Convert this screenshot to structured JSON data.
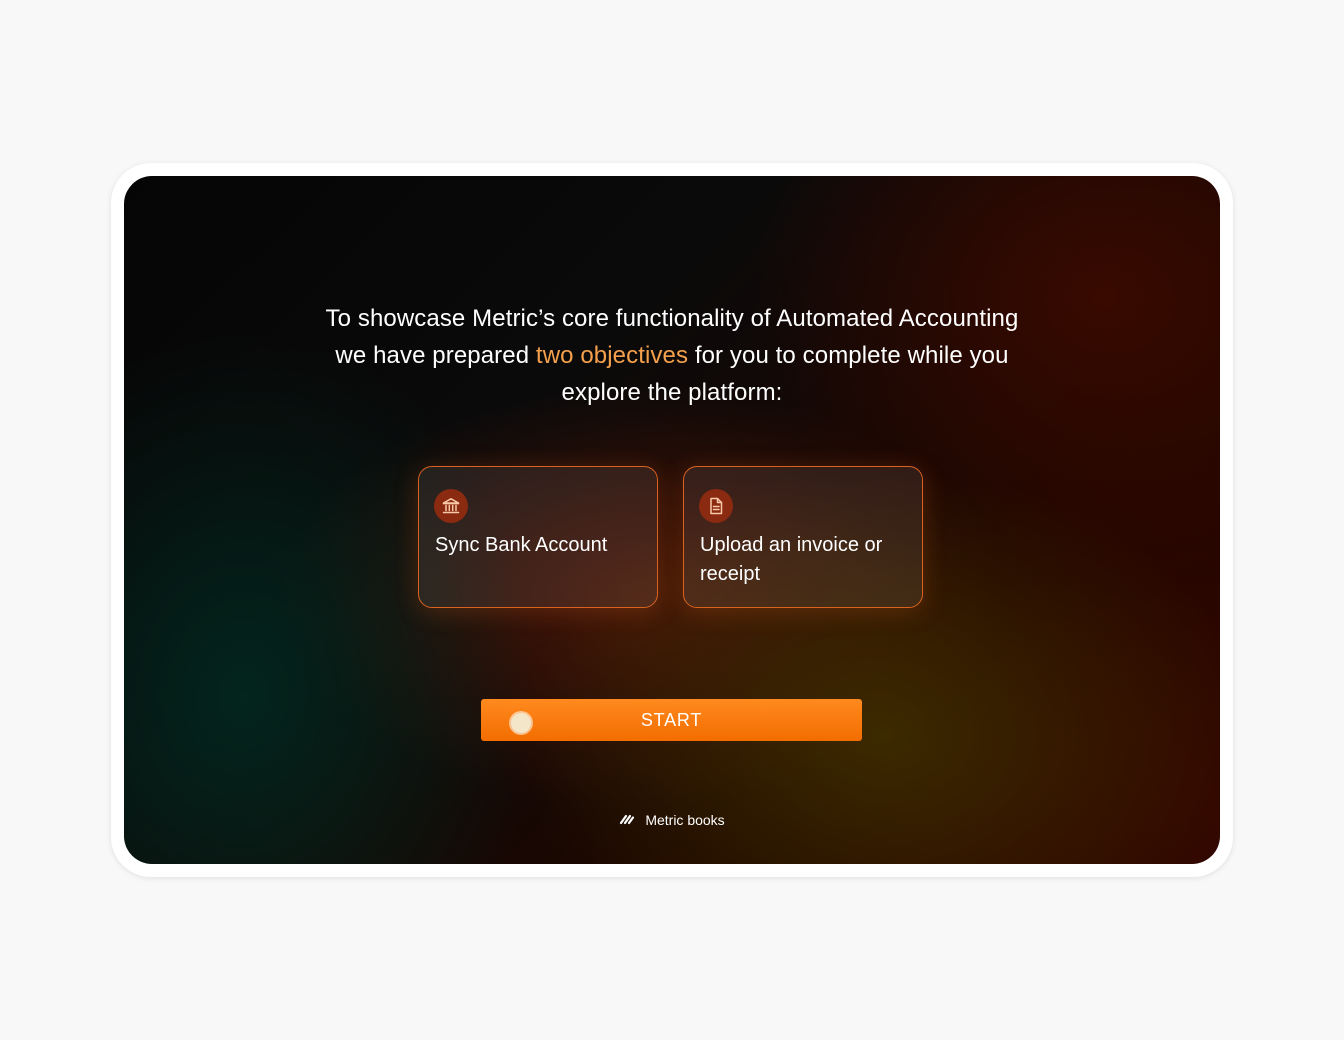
{
  "intro": {
    "text_before": "To showcase Metric’s core functionality of Automated Accounting we have prepared ",
    "highlight": "two objectives",
    "text_after": " for you to complete while you explore the platform:"
  },
  "objectives": [
    {
      "label": "Sync Bank Account",
      "icon": "bank-icon"
    },
    {
      "label": "Upload an invoice or receipt",
      "icon": "document-icon"
    }
  ],
  "start_button": {
    "label": "START"
  },
  "brand": {
    "name": "Metric books",
    "icon": "metric-logo-icon"
  },
  "colors": {
    "accent": "#f36d00",
    "highlight_text": "#f5a04c",
    "card_border": "#d9621e",
    "icon_circle": "#8a2a10"
  }
}
